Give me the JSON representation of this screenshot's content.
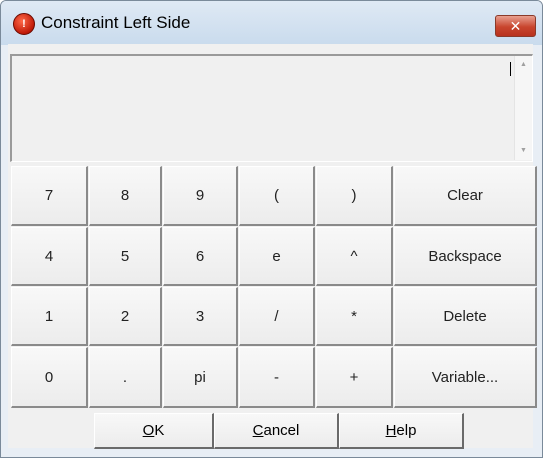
{
  "window": {
    "title": "Constraint Left Side",
    "close_glyph": "✕"
  },
  "expression": {
    "value": ""
  },
  "keypad": {
    "rows": [
      [
        "7",
        "8",
        "9",
        "(",
        ")",
        "Clear"
      ],
      [
        "4",
        "5",
        "6",
        "e",
        "^",
        "Backspace"
      ],
      [
        "1",
        "2",
        "3",
        "/",
        "*",
        "Delete"
      ],
      [
        "0",
        ".",
        "pi",
        "-",
        "+",
        "Variable..."
      ]
    ]
  },
  "buttons": {
    "ok": {
      "mnemonic": "O",
      "rest": "K"
    },
    "cancel": {
      "mnemonic": "C",
      "rest": "ancel"
    },
    "help": {
      "mnemonic": "H",
      "rest": "elp"
    }
  }
}
